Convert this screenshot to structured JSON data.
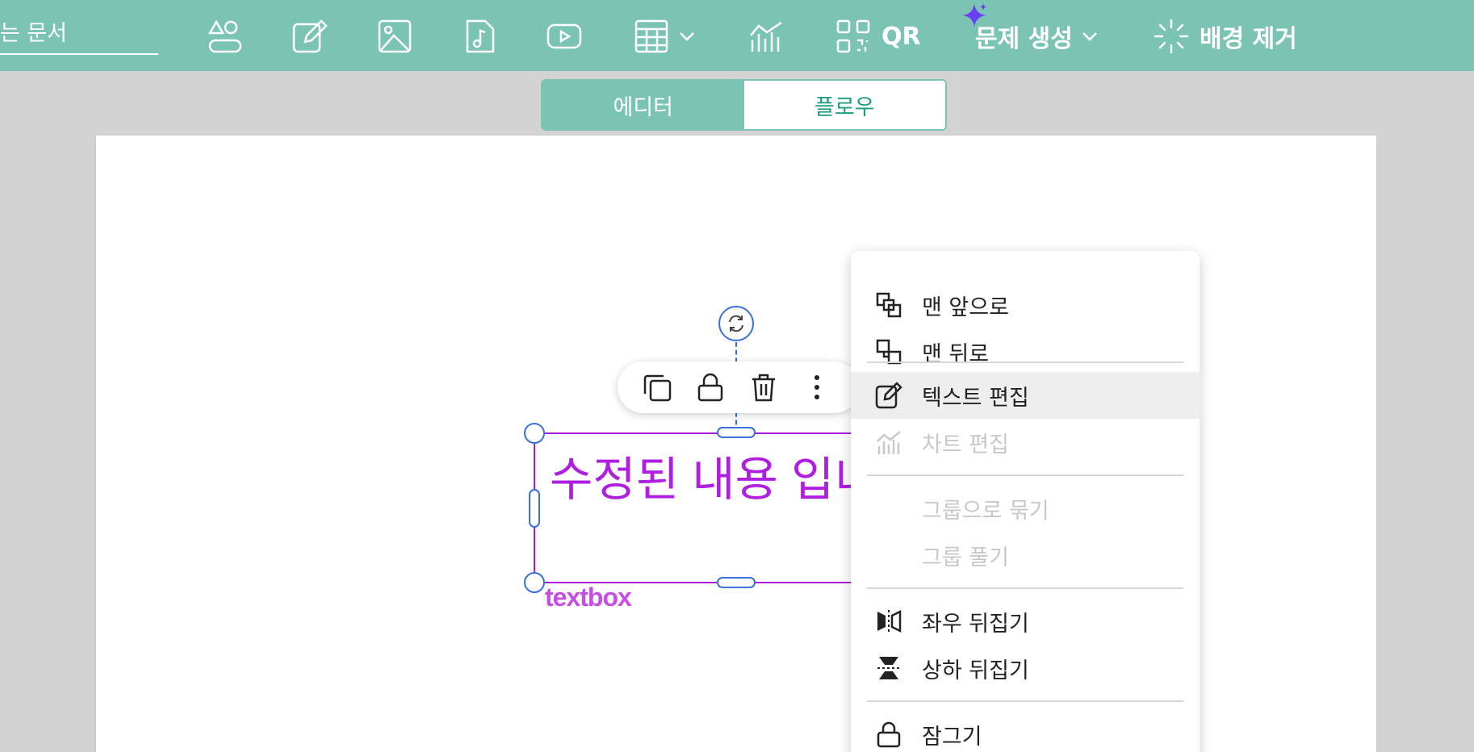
{
  "toolbar": {
    "doc_title": "는 문서",
    "buttons": [
      {
        "name": "shapes-button",
        "icon": "shapes-icon"
      },
      {
        "name": "draw-button",
        "icon": "pencil-icon"
      },
      {
        "name": "image-button",
        "icon": "image-icon"
      },
      {
        "name": "audio-button",
        "icon": "music-file-icon"
      },
      {
        "name": "video-button",
        "icon": "video-play-icon"
      },
      {
        "name": "table-button",
        "icon": "table-icon"
      },
      {
        "name": "chart-button",
        "icon": "chart-icon"
      }
    ],
    "qr_label": "QR",
    "generate_label": "문제 생성",
    "remove_bg_label": "배경 제거"
  },
  "mode_switch": {
    "editor_label": "에디터",
    "flow_label": "플로우",
    "active": "editor"
  },
  "textbox": {
    "content": "수정된 내용 입니다.",
    "type_label": "textbox",
    "text_color": "#b01ee0"
  },
  "mini_toolbar": {
    "items": [
      "copy-icon",
      "lock-icon",
      "trash-icon",
      "more-vertical-icon"
    ]
  },
  "context_menu": {
    "items": [
      {
        "label": "맨 앞으로",
        "icon": "bring-to-front-icon",
        "enabled": true
      },
      {
        "label": "맨 뒤로",
        "icon": "send-to-back-icon",
        "enabled": true
      },
      {
        "label": "텍스트 편집",
        "icon": "edit-text-icon",
        "enabled": true,
        "highlighted": true
      },
      {
        "label": "차트 편집",
        "icon": "chart-icon",
        "enabled": false
      },
      {
        "label": "그룹으로 묶기",
        "icon": "",
        "enabled": false
      },
      {
        "label": "그룹 풀기",
        "icon": "",
        "enabled": false
      },
      {
        "label": "좌우 뒤집기",
        "icon": "flip-horizontal-icon",
        "enabled": true
      },
      {
        "label": "상하 뒤집기",
        "icon": "flip-vertical-icon",
        "enabled": true
      },
      {
        "label": "잠그기",
        "icon": "lock-icon",
        "enabled": true
      }
    ]
  },
  "colors": {
    "accent": "#7bc4b4",
    "selection": "#3a6fe0",
    "text": "#b01ee0"
  }
}
